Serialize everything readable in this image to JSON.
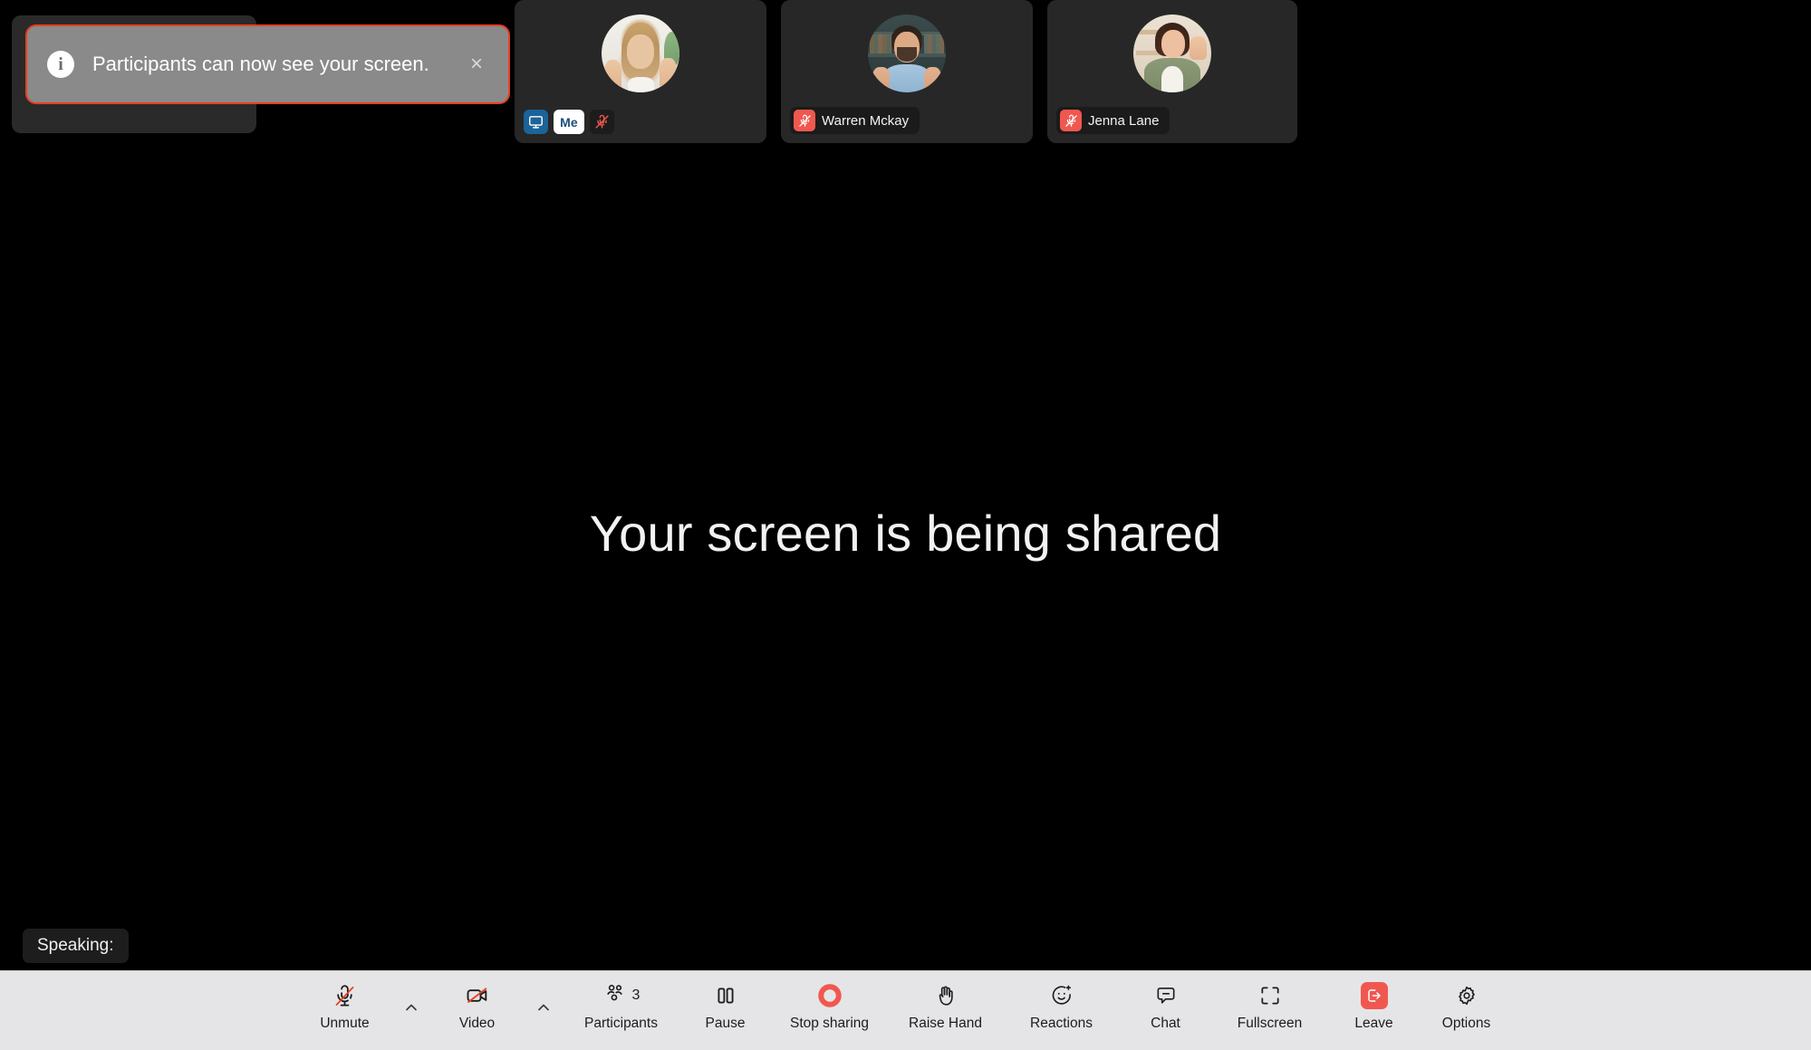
{
  "notification": {
    "icon": "info-icon",
    "message": "Participants can now see your screen.",
    "close_label": "×",
    "border_color": "#e8401f",
    "background_color": "#8a8a8a"
  },
  "filmstrip": {
    "tiles": [
      {
        "id": "me",
        "label": "Me",
        "badges": [
          "screen-share-icon",
          "me-label",
          "mic-muted-icon"
        ],
        "muted": true,
        "sharing": true
      },
      {
        "id": "warren-mckay",
        "label": "Warren Mckay",
        "badges": [
          "mic-muted-icon"
        ],
        "muted": true,
        "sharing": false
      },
      {
        "id": "jenna-lane",
        "label": "Jenna Lane",
        "badges": [
          "mic-muted-icon"
        ],
        "muted": true,
        "sharing": false
      }
    ]
  },
  "stage": {
    "share_message": "Your screen is being shared"
  },
  "speaking": {
    "label": "Speaking:"
  },
  "toolbar": {
    "background_color": "#e5e5e7",
    "buttons": [
      {
        "name": "unmute",
        "label": "Unmute",
        "icon": "mic-muted-icon",
        "has_caret": true,
        "caret_icon": "chevron-up-icon"
      },
      {
        "name": "video",
        "label": "Video",
        "icon": "video-off-icon",
        "has_caret": true,
        "caret_icon": "chevron-up-icon"
      },
      {
        "name": "participants",
        "label": "Participants",
        "icon": "participants-icon",
        "count": "3"
      },
      {
        "name": "pause",
        "label": "Pause",
        "icon": "pause-icon"
      },
      {
        "name": "stop-sharing",
        "label": "Stop sharing",
        "icon": "stop-record-icon",
        "accent": "#f0584f"
      },
      {
        "name": "raise-hand",
        "label": "Raise Hand",
        "icon": "raise-hand-icon"
      },
      {
        "name": "reactions",
        "label": "Reactions",
        "icon": "smiley-reaction-icon"
      },
      {
        "name": "chat",
        "label": "Chat",
        "icon": "chat-bubble-icon"
      },
      {
        "name": "fullscreen",
        "label": "Fullscreen",
        "icon": "fullscreen-icon"
      },
      {
        "name": "leave",
        "label": "Leave",
        "icon": "leave-icon",
        "accent": "#f0584f"
      },
      {
        "name": "options",
        "label": "Options",
        "icon": "gear-icon"
      }
    ]
  },
  "colors": {
    "accent_red": "#f0584f",
    "share_blue": "#1b6398",
    "toast_border": "#e8401f",
    "tile_bg": "#272727",
    "stage_bg": "#000000"
  }
}
